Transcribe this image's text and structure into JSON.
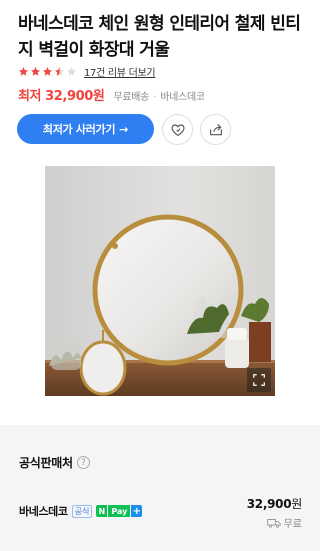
{
  "product": {
    "title": "바네스데코 체인 원형 인테리어 철제 빈티지 벽걸이 화장대 거울",
    "rating": 3.5,
    "rating_max": 5,
    "review_link": "17건 리뷰 더보기",
    "price_prefix": "최저",
    "price": "32,900원",
    "shipping": "무료배송",
    "seller": "바네스데코"
  },
  "actions": {
    "buy_label": "최저가 사러가기",
    "buy_arrow": "→",
    "like_icon": "heart-plus-icon",
    "share_icon": "share-icon"
  },
  "image": {
    "zoom_icon": "expand-icon"
  },
  "official_sellers": {
    "title": "공식판매처",
    "help": "?",
    "rows": [
      {
        "name": "바네스데코",
        "official_badge": "공식",
        "npay_n": "N",
        "npay_label": "Pay",
        "npay_plus": "+",
        "price_number": "32,900",
        "price_unit": "원",
        "shipping": "무료"
      }
    ]
  },
  "colors": {
    "accent": "#2f7ff3",
    "price": "#f0433b",
    "star": "#f0433b",
    "npay": "#0fc154"
  }
}
